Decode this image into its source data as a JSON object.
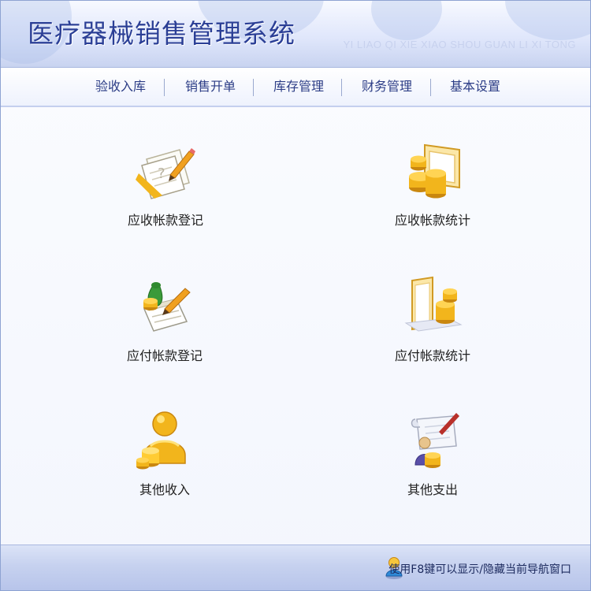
{
  "header": {
    "title": "医疗器械销售管理系统",
    "pinyin": "YI LIAO QI XIE XIAO SHOU GUAN LI XI TONG"
  },
  "nav": {
    "items": [
      {
        "label": "验收入库"
      },
      {
        "label": "销售开单"
      },
      {
        "label": "库存管理"
      },
      {
        "label": "财务管理"
      },
      {
        "label": "基本设置"
      }
    ]
  },
  "tiles": [
    {
      "label": "应收帐款登记",
      "icon": "notebook-pencil-icon"
    },
    {
      "label": "应收帐款统计",
      "icon": "coins-card-icon"
    },
    {
      "label": "应付帐款登记",
      "icon": "money-bag-notepad-icon"
    },
    {
      "label": "应付帐款统计",
      "icon": "coins-chart-icon"
    },
    {
      "label": "其他收入",
      "icon": "person-coins-icon"
    },
    {
      "label": "其他支出",
      "icon": "document-coins-icon"
    }
  ],
  "status": {
    "hint": "使用F8键可以显示/隐藏当前导航窗口",
    "hint_icon": "user-icon"
  },
  "colors": {
    "title": "#2b3f96",
    "nav_text": "#2c3d86",
    "header_bg": "#dfe6fb",
    "status_bg": "#c6d1ef",
    "gold": "#f2b51c"
  }
}
